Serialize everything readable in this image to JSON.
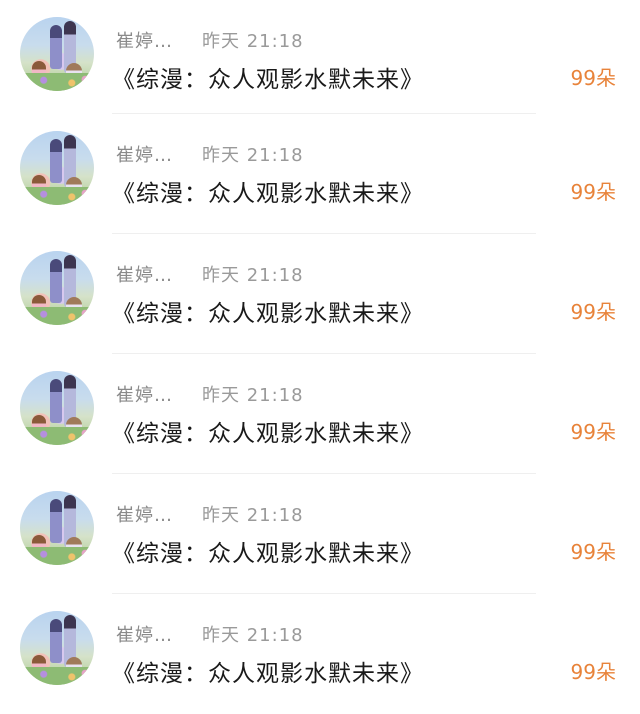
{
  "messages": [
    {
      "sender": "崔婷…",
      "time": "昨天 21:18",
      "title": "《综漫：众人观影水默未来》",
      "gift": "99朵"
    },
    {
      "sender": "崔婷…",
      "time": "昨天 21:18",
      "title": "《综漫：众人观影水默未来》",
      "gift": "99朵"
    },
    {
      "sender": "崔婷…",
      "time": "昨天 21:18",
      "title": "《综漫：众人观影水默未来》",
      "gift": "99朵"
    },
    {
      "sender": "崔婷…",
      "time": "昨天 21:18",
      "title": "《综漫：众人观影水默未来》",
      "gift": "99朵"
    },
    {
      "sender": "崔婷…",
      "time": "昨天 21:18",
      "title": "《综漫：众人观影水默未来》",
      "gift": "99朵"
    },
    {
      "sender": "崔婷…",
      "time": "昨天 21:18",
      "title": "《综漫：众人观影水默未来》",
      "gift": "99朵"
    }
  ],
  "colors": {
    "gift": "#e8833a",
    "title": "#1a1a1a",
    "meta": "#8a8a8a"
  }
}
